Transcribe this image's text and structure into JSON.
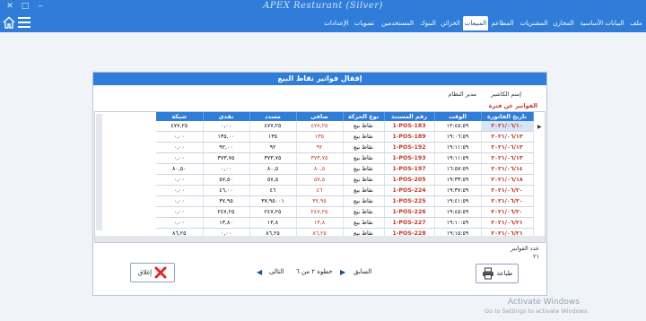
{
  "window": {
    "title": "APEX Resturant (Silver)",
    "minimize": "‒",
    "maximize": "□",
    "close": "✕"
  },
  "menu": [
    {
      "label": "ملف"
    },
    {
      "label": "البيانات الأساسية"
    },
    {
      "label": "المخازن"
    },
    {
      "label": "المشتريات"
    },
    {
      "label": "المطاعم"
    },
    {
      "label": "المبيعات",
      "active": true
    },
    {
      "label": "الخزائن"
    },
    {
      "label": "البنوك"
    },
    {
      "label": "المستخدمين"
    },
    {
      "label": "تسويات"
    },
    {
      "label": "الإعدادات"
    }
  ],
  "dialog": {
    "title": "إقفال فواتير نقاط البيع",
    "cashier_label": "إسم الكاشير",
    "cashier_value": "مدير النظام",
    "section_label": "الفواتير عن فترة",
    "columns": [
      "تاريخ الفاتورة",
      "الوقت",
      "رقم المستند",
      "نوع الحركة",
      "صافى",
      "مسدد",
      "نقدى",
      "شبكة"
    ],
    "rows": [
      [
        "٢٠٢١/٠٦/١٠",
        "١٢:٤٥:٥٩",
        "1-POS-183",
        "نقاط بيع",
        "٤٧٧,٢٥",
        "٤٧٧,٢٥",
        "٠,٠٠",
        "٤٧٧,٢٥"
      ],
      [
        "٢٠٢١/٠٦/١٣",
        "١٩:٠٦:٥٩",
        "1-POS-189",
        "نقاط بيع",
        "١٣٥",
        "١٣٥",
        "١٣٥,٠٠",
        "٠,٠٠"
      ],
      [
        "٢٠٢١/٠٦/١٣",
        "١٩:١١:٥٩",
        "1-POS-192",
        "نقاط بيع",
        "٩٢",
        "٩٢",
        "٩٢,٠٠",
        "٠,٠٠"
      ],
      [
        "٢٠٢١/٠٦/١٣",
        "١٩:١١:٥٩",
        "1-POS-193",
        "نقاط بيع",
        "٣٧٣,٧٥",
        "٣٧٣,٧٥",
        "٣٧٣,٧٥",
        "٠,٠٠"
      ],
      [
        "٢٠٢١/٠٦/١٤",
        "١٦:٥٧:٥٩",
        "1-POS-197",
        "نقاط بيع",
        "٨٠,٥",
        "٨٠,٥",
        "٠,٠٠",
        "٨٠,٥٠"
      ],
      [
        "٢٠٢١/٠٦/١٨",
        "١٩:٣٣:٥٩",
        "1-POS-205",
        "نقاط بيع",
        "٥٧,٥",
        "٥٧,٥",
        "٥٧,٥٠",
        "٠,٠٠"
      ],
      [
        "٢٠٢١/٠٦/٢٠",
        "١٩:٣٧:٥٩",
        "1-POS-224",
        "نقاط بيع",
        "٤٦",
        "٤٦",
        "٤٦,٠٠",
        "٠,٠٠"
      ],
      [
        "٢٠٢١/٠٦/٢٠",
        "١٩:٤١:٥٩",
        "1-POS-225",
        "نقاط بيع",
        "٣٧,٩٥",
        "٣٧,٩٥٠٠١",
        "٣٧,٩٥",
        "٠,٠٠"
      ],
      [
        "٢٠٢١/٠٦/٢٠",
        "١٩:٤٥:٥٩",
        "1-POS-226",
        "نقاط بيع",
        "٢٤٧,٢٥",
        "٢٤٧,٢٥",
        "٢٤٧,٢٥",
        "٠,٠٠"
      ],
      [
        "٢٠٢١/٠٦/٢١",
        "١٩:١٠:٥٩",
        "1-POS-227",
        "نقاط بيع",
        "١٣,٨",
        "١٣,٨",
        "١٣,٨٠",
        "٠,٠٠"
      ],
      [
        "٢٠٢١/٠٦/٢١",
        "١٩:١٥:٥٩",
        "1-POS-228",
        "نقاط بيع",
        "٨٦,٢٥",
        "٨٦,٢٥",
        "٠,٠٠",
        "٨٦,٢٥"
      ],
      [
        "٢٠٢١/٠٦/٢١",
        "١٩:١٩:٥٩",
        "1-POS-229",
        "نقاط بيع",
        "٥٦,٢٥",
        "٥٦,٢٥",
        "٠,٠٠",
        "٥٦,٢٥"
      ],
      [
        "٢٠٢١/٠٦/٢٢",
        "١٩:٢٠:٥٩",
        "1-POS-230",
        "نقاط بيع",
        "٣٢٧,٧٥",
        "٣٢٧,٧٥",
        "٠,٠٠",
        "٣٢٧,٧٥"
      ]
    ],
    "count_label": "عدد الفواتير",
    "count_value": "٢١",
    "close_label": "إغلاق",
    "print_label": "طباعة",
    "prev_label": "السابق",
    "step_label": "خطوة ٢ من ٦",
    "next_label": "التالى"
  },
  "watermark": {
    "line1": "Activate Windows",
    "line2": "Go to Settings to activate Windows."
  }
}
